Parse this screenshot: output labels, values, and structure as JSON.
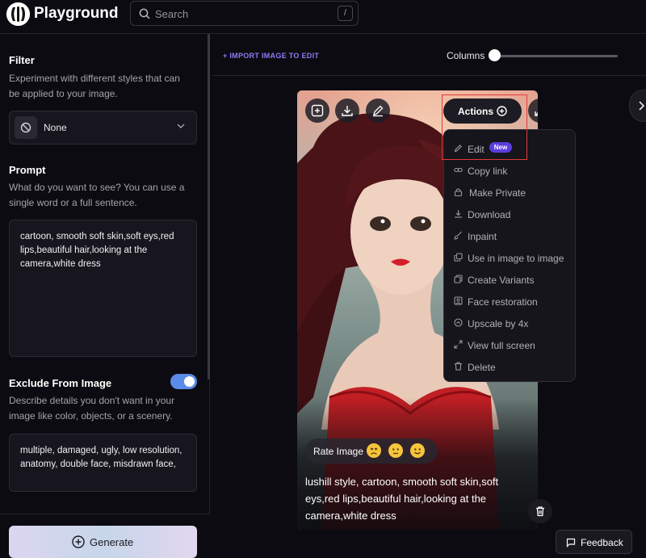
{
  "app": {
    "title": "Playground"
  },
  "search": {
    "placeholder": "Search",
    "shortcut": "/"
  },
  "sidebar": {
    "filter": {
      "heading": "Filter",
      "description": "Experiment with different styles that can be applied to your image.",
      "selected": "None"
    },
    "prompt": {
      "heading": "Prompt",
      "description": "What do you want to see? You can use a single word or a full sentence.",
      "value": "cartoon, smooth soft skin,soft eys,red lips,beautiful hair,looking at the camera,white dress"
    },
    "exclude": {
      "heading": "Exclude From Image",
      "enabled": true,
      "description": "Describe details you don't want in your image like color, objects, or a scenery.",
      "value": "multiple, damaged, ugly, low resolution, anatomy, double face, misdrawn face,"
    },
    "generate_label": "Generate"
  },
  "main": {
    "import_label": "+ IMPORT IMAGE TO EDIT",
    "columns_label": "Columns"
  },
  "card": {
    "actions_label": "Actions",
    "rate_label": "Rate Image",
    "caption": "lushill style, cartoon, smooth soft skin,soft eys,red lips,beautiful hair,looking at the camera,white dress"
  },
  "menu": {
    "items": [
      {
        "label": "Edit",
        "icon": "pencil-icon",
        "badge": "New"
      },
      {
        "label": "Copy link",
        "icon": "link-icon"
      },
      {
        "label": "Make Private",
        "icon": "lock-icon"
      },
      {
        "label": "Download",
        "icon": "download-icon"
      },
      {
        "label": "Inpaint",
        "icon": "brush-icon"
      },
      {
        "label": "Use in image to image",
        "icon": "copy-icon"
      },
      {
        "label": "Create Variants",
        "icon": "layers-icon"
      },
      {
        "label": "Face restoration",
        "icon": "face-icon"
      },
      {
        "label": "Upscale by 4x",
        "icon": "upscale-icon"
      },
      {
        "label": "View full screen",
        "icon": "expand-icon"
      },
      {
        "label": "Delete",
        "icon": "trash-icon"
      }
    ]
  },
  "feedback": {
    "label": "Feedback"
  },
  "colors": {
    "accent": "#8d7bf3",
    "toggle": "#5b8be8",
    "badge": "#5b3ee0",
    "highlight": "#e23a3a",
    "lips": "#d41f2a"
  }
}
